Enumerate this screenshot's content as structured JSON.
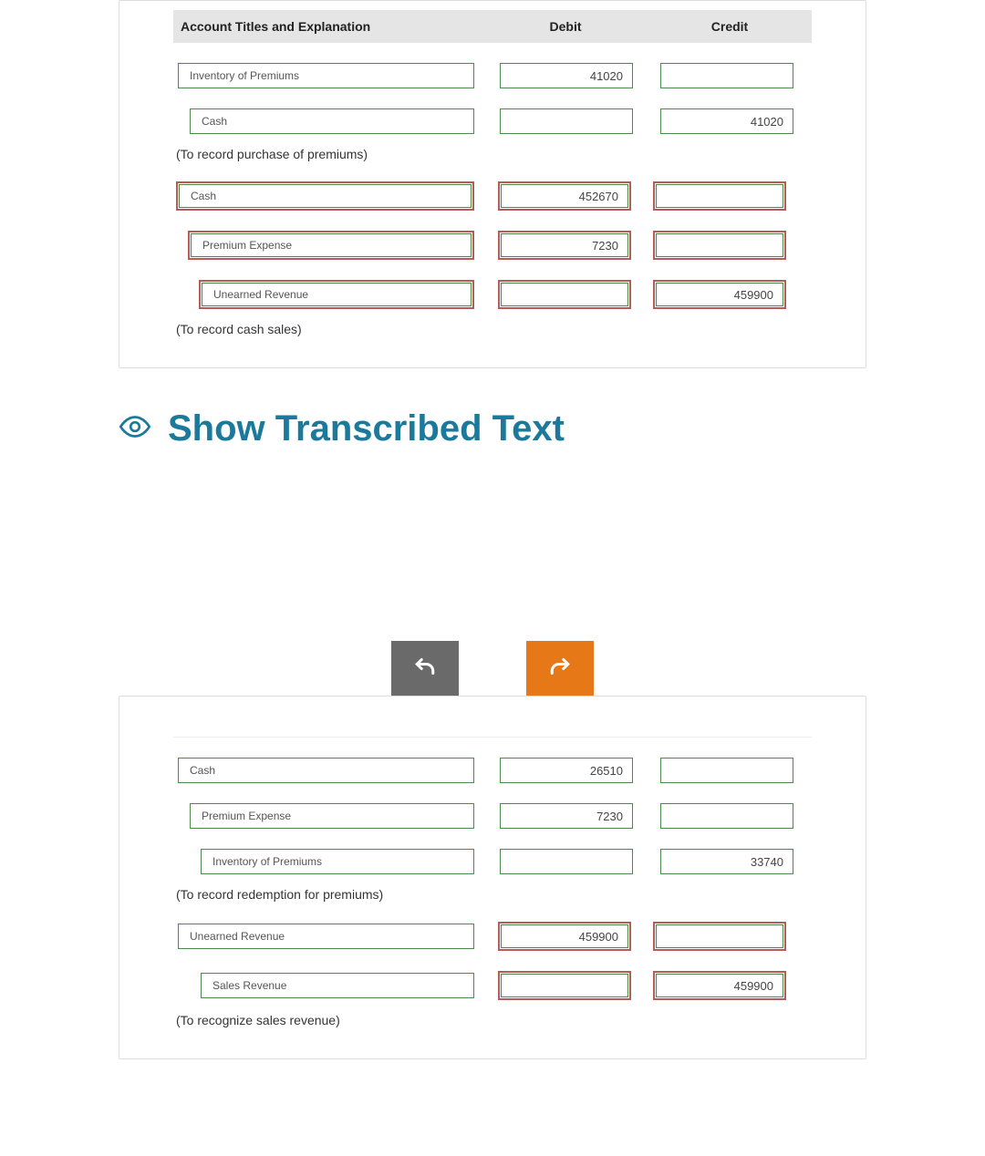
{
  "table": {
    "headers": {
      "title": "Account Titles and Explanation",
      "debit": "Debit",
      "credit": "Credit"
    }
  },
  "section1": {
    "rows": [
      {
        "account": "Inventory of Premiums",
        "debit": "41020",
        "credit": "",
        "indent": 0,
        "status": "ok"
      },
      {
        "account": "Cash",
        "debit": "",
        "credit": "41020",
        "indent": 1,
        "status": "ok"
      }
    ],
    "explain": "(To record purchase of premiums)",
    "rows2": [
      {
        "account": "Cash",
        "debit": "452670",
        "credit": "",
        "indent": 0,
        "status": "err"
      },
      {
        "account": "Premium Expense",
        "debit": "7230",
        "credit": "",
        "indent": 1,
        "status": "err"
      },
      {
        "account": "Unearned Revenue",
        "debit": "",
        "credit": "459900",
        "indent": 2,
        "status": "err"
      }
    ],
    "explain2": "(To record cash sales)"
  },
  "transcribed": {
    "label": "Show Transcribed Text"
  },
  "section2": {
    "rows": [
      {
        "account": "Cash",
        "debit": "26510",
        "credit": "",
        "indent": 0,
        "status": "ok"
      },
      {
        "account": "Premium Expense",
        "debit": "7230",
        "credit": "",
        "indent": 1,
        "status": "ok"
      },
      {
        "account": "Inventory of Premiums",
        "debit": "",
        "credit": "33740",
        "indent": 2,
        "status": "ok"
      }
    ],
    "explain": "(To record redemption for premiums)",
    "rows2": [
      {
        "account": "Unearned Revenue",
        "debit": "459900",
        "credit": "",
        "indent": 0,
        "status": "err-mixed"
      },
      {
        "account": "Sales Revenue",
        "debit": "",
        "credit": "459900",
        "indent": 2,
        "status": "err-mixed"
      }
    ],
    "explain2": "(To recognize sales revenue)"
  }
}
